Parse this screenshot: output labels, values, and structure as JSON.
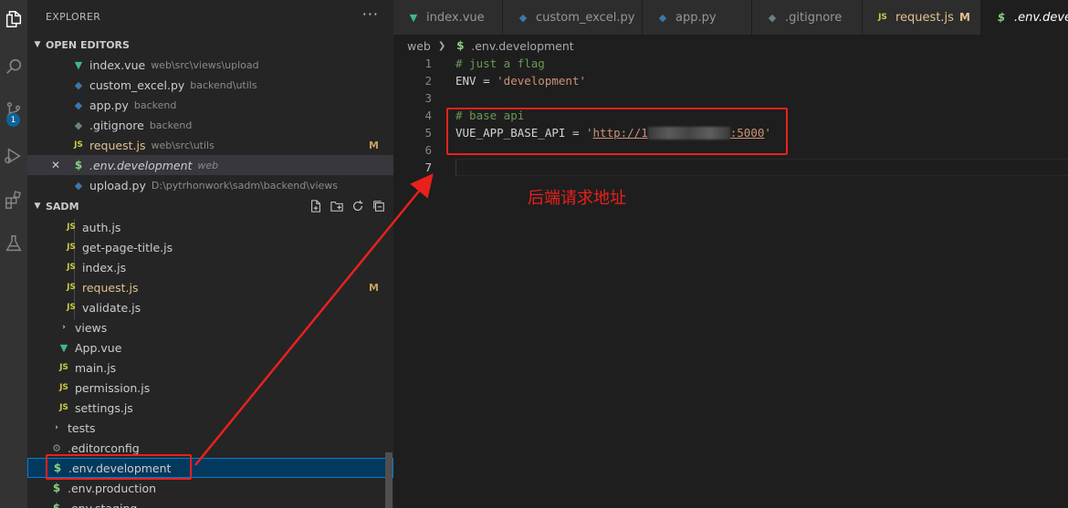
{
  "activity": {
    "icons": [
      "files-icon",
      "search-icon",
      "source-control-icon",
      "run-debug-icon",
      "extensions-icon",
      "test-flask-icon"
    ],
    "scm_badge": "1"
  },
  "explorer": {
    "title": "EXPLORER",
    "more": "···",
    "open_editors": {
      "title": "OPEN EDITORS",
      "items": [
        {
          "icon": "vue",
          "name": "index.vue",
          "path": "web\\src\\views\\upload",
          "mod": ""
        },
        {
          "icon": "py",
          "name": "custom_excel.py",
          "path": "backend\\utils",
          "mod": ""
        },
        {
          "icon": "py",
          "name": "app.py",
          "path": "backend",
          "mod": ""
        },
        {
          "icon": "git",
          "name": ".gitignore",
          "path": "backend",
          "mod": ""
        },
        {
          "icon": "js",
          "name": "request.js",
          "path": "web\\src\\utils",
          "mod": "M"
        },
        {
          "icon": "env",
          "name": ".env.development",
          "path": "web",
          "mod": ""
        },
        {
          "icon": "py",
          "name": "upload.py",
          "path": "D:\\pytrhonwork\\sadm\\backend\\views",
          "mod": ""
        }
      ]
    },
    "project": {
      "title": "SADM",
      "tree": [
        {
          "icon": "js",
          "name": "auth.js",
          "mod": ""
        },
        {
          "icon": "js",
          "name": "get-page-title.js",
          "mod": ""
        },
        {
          "icon": "js",
          "name": "index.js",
          "mod": ""
        },
        {
          "icon": "js",
          "name": "request.js",
          "mod": "M"
        },
        {
          "icon": "js",
          "name": "validate.js",
          "mod": ""
        },
        {
          "icon": "chev",
          "name": "views",
          "mod": ""
        },
        {
          "icon": "vue",
          "name": "App.vue",
          "mod": ""
        },
        {
          "icon": "js",
          "name": "main.js",
          "mod": ""
        },
        {
          "icon": "js",
          "name": "permission.js",
          "mod": ""
        },
        {
          "icon": "js",
          "name": "settings.js",
          "mod": ""
        },
        {
          "icon": "chev",
          "name": "tests",
          "mod": ""
        },
        {
          "icon": "cfg",
          "name": ".editorconfig",
          "mod": ""
        },
        {
          "icon": "env",
          "name": ".env.development",
          "mod": ""
        },
        {
          "icon": "env",
          "name": ".env.production",
          "mod": ""
        },
        {
          "icon": "env",
          "name": ".env.staging",
          "mod": ""
        }
      ]
    }
  },
  "tabs": [
    {
      "icon": "vue",
      "label": "index.vue",
      "mod": ""
    },
    {
      "icon": "py",
      "label": "custom_excel.py",
      "mod": ""
    },
    {
      "icon": "py",
      "label": "app.py",
      "mod": ""
    },
    {
      "icon": "git",
      "label": ".gitignore",
      "mod": ""
    },
    {
      "icon": "js",
      "label": "request.js",
      "mod": "M"
    },
    {
      "icon": "env",
      "label": ".env.development",
      "mod": ""
    }
  ],
  "breadcrumb": {
    "folder": "web",
    "file": ".env.development"
  },
  "editor": {
    "lines": [
      {
        "n": "1",
        "comment": "# just a flag"
      },
      {
        "n": "2",
        "key": "ENV",
        "eq": " = ",
        "value": "'development'"
      },
      {
        "n": "3"
      },
      {
        "n": "4",
        "comment": "# base api"
      },
      {
        "n": "5",
        "key": "VUE_APP_BASE_API",
        "eq": " = ",
        "q": "'",
        "url_start": "http://1",
        "url_end": ":5000",
        "q2": "'"
      },
      {
        "n": "6"
      },
      {
        "n": "7"
      }
    ]
  },
  "annotation": {
    "text": "后端请求地址",
    "color": "#e8211d"
  }
}
